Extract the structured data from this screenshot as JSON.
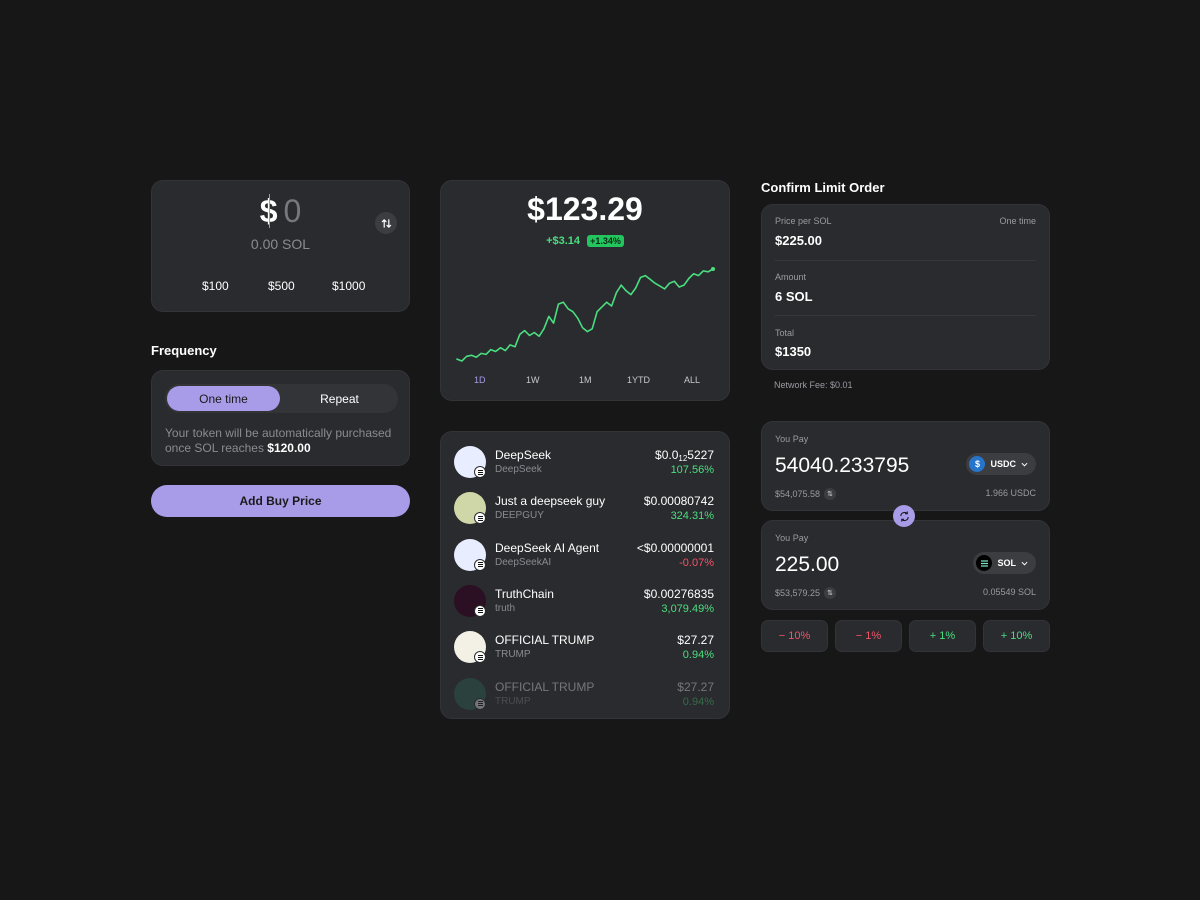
{
  "buy": {
    "currency_symbol": "$",
    "amount": "0",
    "sol_amount": "0.00 SOL",
    "quick_amounts": [
      "$100",
      "$500",
      "$1000"
    ]
  },
  "frequency": {
    "title": "Frequency",
    "options": [
      "One time",
      "Repeat"
    ],
    "selected": "One time",
    "note_prefix": "Your token will be automatically purchased once SOL reaches ",
    "note_price": "$120.00",
    "add_button": "Add Buy Price"
  },
  "chart": {
    "price": "$123.29",
    "change": "+$3.14",
    "change_pct": "+1.34%",
    "ranges": [
      "1D",
      "1W",
      "1M",
      "1YTD",
      "ALL"
    ],
    "active_range": "1D"
  },
  "chart_data": {
    "type": "line",
    "title": "",
    "xlabel": "",
    "ylabel": "",
    "grid": false,
    "series": [
      {
        "values": [
          40,
          38,
          43,
          44,
          42,
          46,
          45,
          50,
          48,
          52,
          49,
          55,
          53,
          66,
          70,
          65,
          68,
          64,
          72,
          85,
          78,
          98,
          100,
          93,
          90,
          83,
          73,
          69,
          72,
          90,
          95,
          100,
          96,
          110,
          118,
          112,
          108,
          115,
          126,
          128,
          124,
          120,
          117,
          114,
          120,
          122,
          116,
          118,
          125,
          130,
          128,
          133,
          132,
          135
        ]
      }
    ],
    "colors": {
      "line": "#4ade80"
    }
  },
  "tokens": [
    {
      "name": "DeepSeek",
      "symbol": "DeepSeek",
      "price_main": "$0.0",
      "price_sub": "12",
      "price_tail": "5227",
      "change": "107.56%",
      "direction": "up",
      "icon": "deepseek-whale-icon",
      "color": "#e8edff",
      "dim": false
    },
    {
      "name": "Just a deepseek guy",
      "symbol": "DEEPGUY",
      "price_main": "$0.00080742",
      "price_sub": "",
      "price_tail": "",
      "change": "324.31%",
      "direction": "up",
      "icon": "deepguy-avatar-icon",
      "color": "#cfd6a8",
      "dim": false
    },
    {
      "name": "DeepSeek AI Agent",
      "symbol": "DeepSeekAI",
      "price_main": "<$0.00000001",
      "price_sub": "",
      "price_tail": "",
      "change": "-0.07%",
      "direction": "down",
      "icon": "deepseek-ai-icon",
      "color": "#e8edff",
      "dim": false
    },
    {
      "name": "TruthChain",
      "symbol": "truth",
      "price_main": "$0.00276835",
      "price_sub": "",
      "price_tail": "",
      "change": "3,079.49%",
      "direction": "up",
      "icon": "truthchain-icon",
      "color": "#2b0f22",
      "dim": false
    },
    {
      "name": "OFFICIAL TRUMP",
      "symbol": "TRUMP",
      "price_main": "$27.27",
      "price_sub": "",
      "price_tail": "",
      "change": "0.94%",
      "direction": "up",
      "icon": "trump-card-icon",
      "color": "#f3f0e6",
      "dim": false
    },
    {
      "name": "OFFICIAL TRUMP",
      "symbol": "TRUMP",
      "price_main": "$27.27",
      "price_sub": "",
      "price_tail": "",
      "change": "0.94%",
      "direction": "up",
      "icon": "placeholder-token-icon",
      "color": "#2f6b5a",
      "dim": true
    }
  ],
  "limit_order": {
    "title": "Confirm Limit Order",
    "price_label": "Price per SOL",
    "price_value": "$225.00",
    "frequency": "One time",
    "amount_label": "Amount",
    "amount_value": "6 SOL",
    "total_label": "Total",
    "total_value": "$1350",
    "network_fee": "Network Fee: $0.01"
  },
  "pay_top": {
    "label": "You Pay",
    "amount": "54040.233795",
    "usd": "$54,075.58",
    "token": "USDC",
    "balance": "1.966 USDC"
  },
  "pay_bottom": {
    "label": "You Pay",
    "amount": "225.00",
    "usd": "$53,579.25",
    "token": "SOL",
    "balance": "0.05549 SOL"
  },
  "adjust": [
    {
      "sign": "−",
      "label": "10%",
      "direction": "down"
    },
    {
      "sign": "−",
      "label": "1%",
      "direction": "down"
    },
    {
      "sign": "+",
      "label": "1%",
      "direction": "up"
    },
    {
      "sign": "+",
      "label": "10%",
      "direction": "up"
    }
  ]
}
